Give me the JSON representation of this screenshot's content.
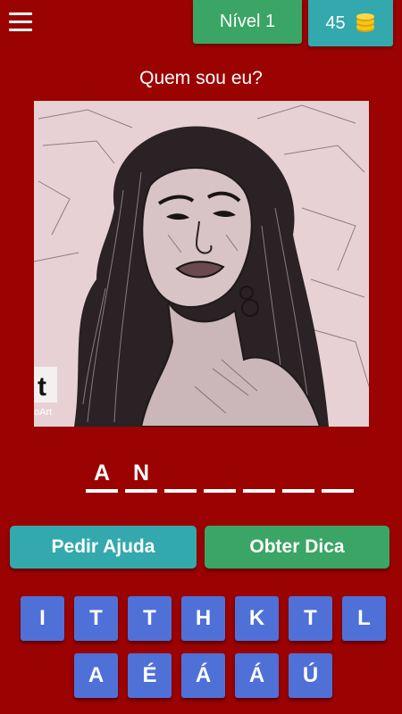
{
  "header": {
    "level_label": "Nível 1",
    "coins": "45"
  },
  "question": "Quem sou eu?",
  "portrait": {
    "watermark_letter": "t",
    "watermark_text": "oArt"
  },
  "answer_slots": [
    "A",
    "N",
    "",
    "",
    "",
    "",
    ""
  ],
  "actions": {
    "help_label": "Pedir Ajuda",
    "hint_label": "Obter Dica"
  },
  "keyboard": {
    "row1": [
      "I",
      "T",
      "T",
      "H",
      "K",
      "T",
      "L"
    ],
    "row2": [
      "A",
      "É",
      "Á",
      "Á",
      "Ú"
    ]
  },
  "colors": {
    "background": "#9b0202",
    "level_green": "#3aa564",
    "coins_teal": "#33a8ad",
    "key_blue": "#4f70d7",
    "coin_gold": "#f5c518"
  }
}
